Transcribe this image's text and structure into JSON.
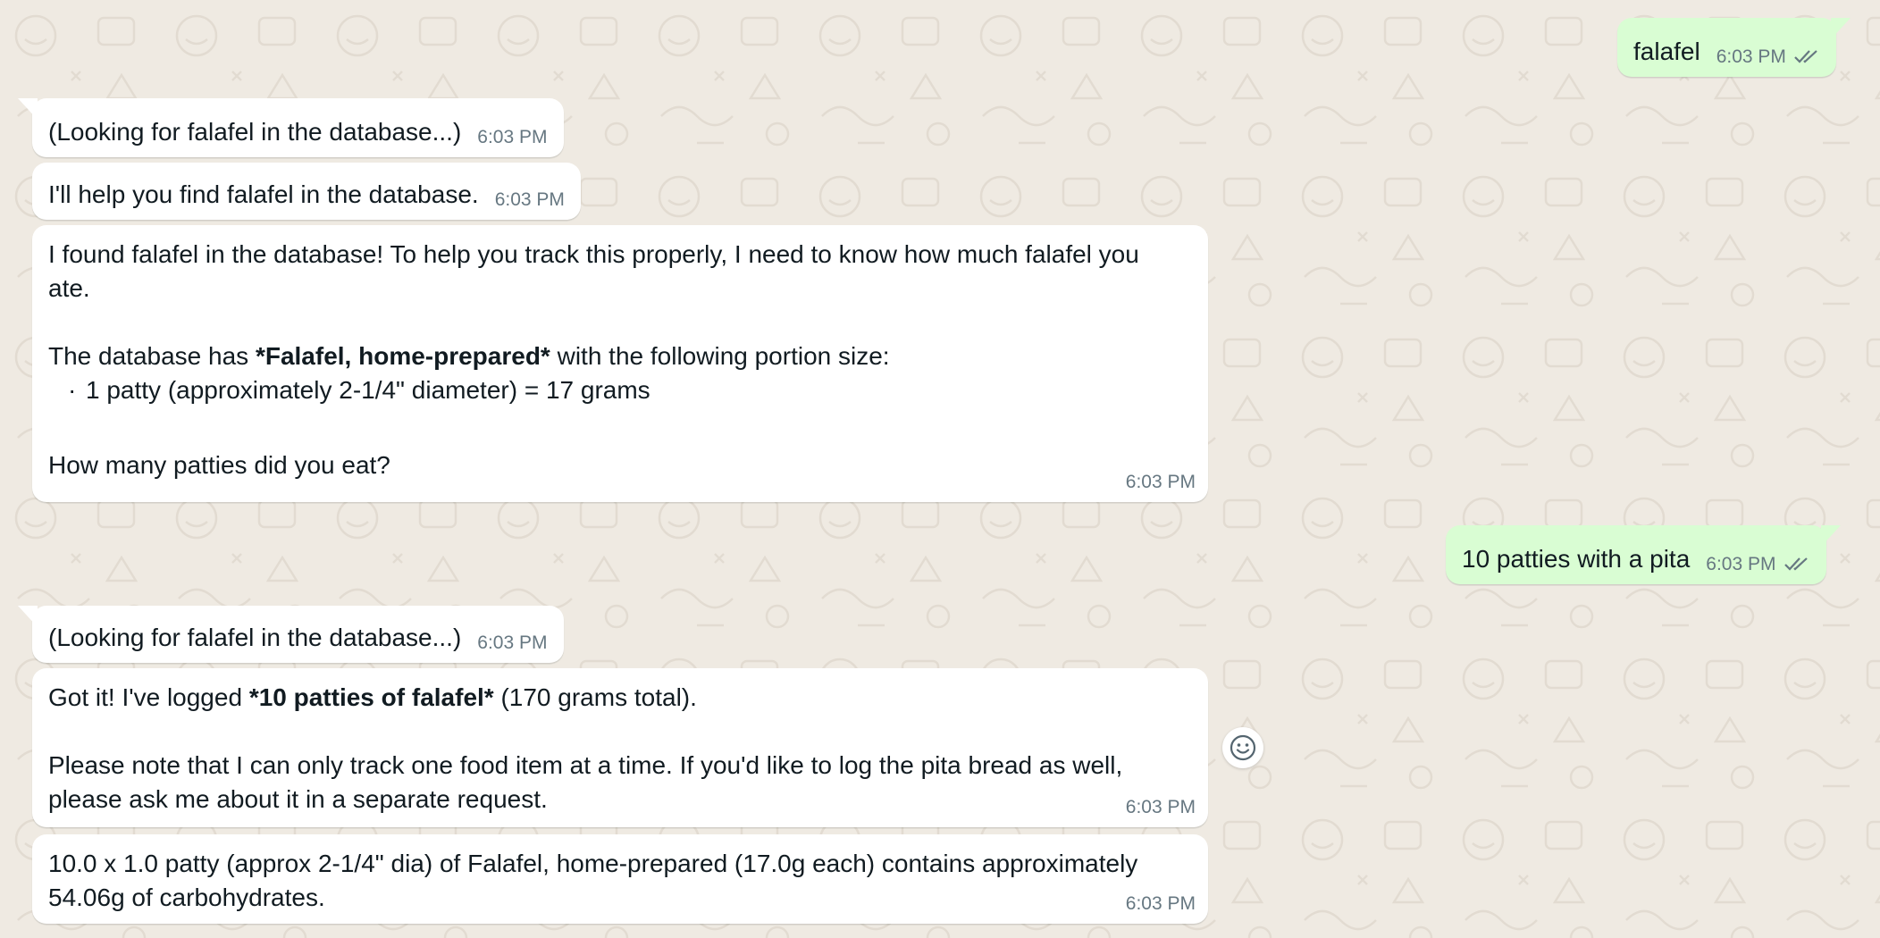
{
  "colors": {
    "background": "#efeae2",
    "incoming_bubble": "#ffffff",
    "outgoing_bubble": "#d9fdd3",
    "timestamp": "#667781",
    "read_ticks": "#667781"
  },
  "messages": [
    {
      "direction": "outgoing",
      "text": "falafel",
      "time": "6:03 PM",
      "status": "read"
    },
    {
      "direction": "incoming",
      "text": "(Looking for falafel in the database...)",
      "time": "6:03 PM"
    },
    {
      "direction": "incoming",
      "text": "I'll help you find falafel in the database.",
      "time": "6:03 PM"
    },
    {
      "direction": "incoming",
      "line1": "I found falafel in the database! To help you track this properly, I need to know how much falafel you",
      "line2": "ate.",
      "portion_prefix": "The database has ",
      "portion_bold": "*Falafel, home-prepared*",
      "portion_suffix": " with the following portion size:",
      "bullet": "1 patty (approximately 2-1/4\" diameter) = 17 grams",
      "question": "How many patties did you eat?",
      "time": "6:03 PM"
    },
    {
      "direction": "outgoing",
      "text": "10 patties with a pita",
      "time": "6:03 PM",
      "status": "read"
    },
    {
      "direction": "incoming",
      "text": "(Looking for falafel in the database...)",
      "time": "6:03 PM"
    },
    {
      "direction": "incoming",
      "logged_prefix": "Got it! I've logged ",
      "logged_bold": "*10 patties of falafel*",
      "logged_suffix": " (170 grams total).",
      "note_line1": "Please note that I can only track one food item at a time. If you'd like to log the pita bread as well,",
      "note_line2": "please ask me about it in a separate request.",
      "time": "6:03 PM"
    },
    {
      "direction": "incoming",
      "line1": "10.0 x 1.0 patty (approx 2-1/4\" dia) of Falafel, home-prepared (17.0g each) contains approximately",
      "line2": "54.06g of carbohydrates.",
      "time": "6:03 PM"
    }
  ],
  "reaction_button": {
    "icon": "smiley-face-icon"
  }
}
